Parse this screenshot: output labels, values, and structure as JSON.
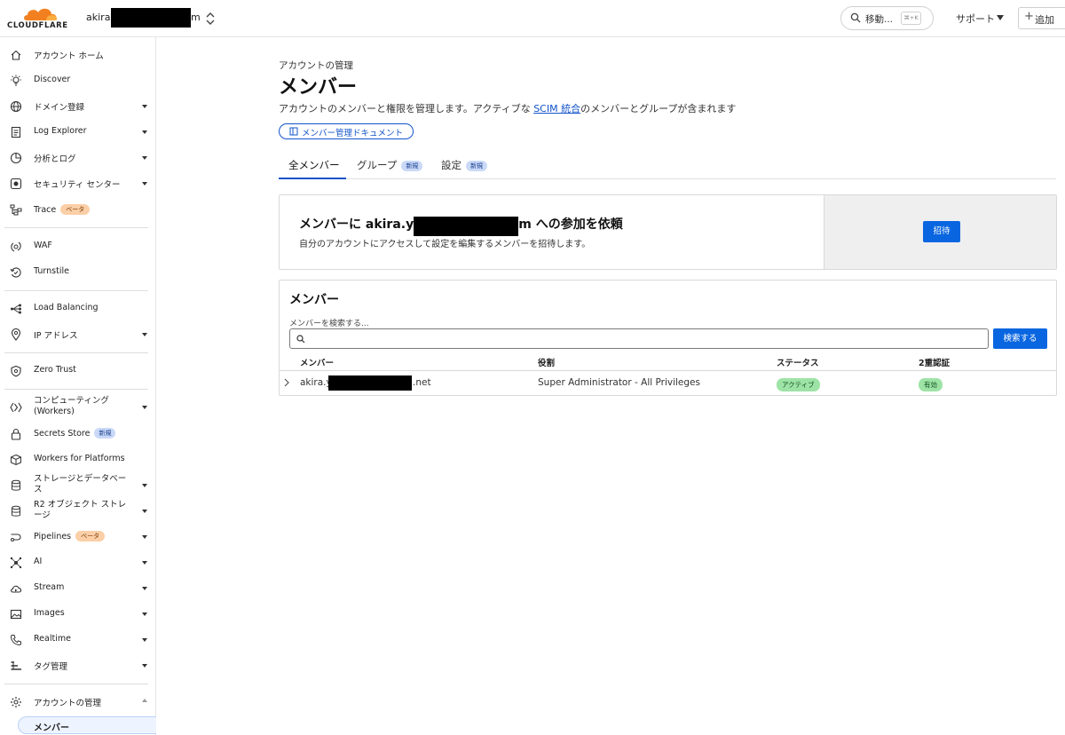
{
  "header": {
    "logo_text": "CLOUDFLARE",
    "account_name_prefix": "akira.y",
    "account_name_suffix": "m",
    "goto_label": "移動...",
    "goto_shortcut": "⌘+K",
    "support_label": "サポート",
    "add_label": "追加"
  },
  "sidebar": {
    "items": [
      {
        "label": "アカウント ホーム",
        "icon": "home-icon"
      },
      {
        "label": "Discover",
        "icon": "lightbulb-icon"
      },
      {
        "label": "ドメイン登録",
        "icon": "globe-icon"
      },
      {
        "label": "Log Explorer",
        "icon": "document-icon"
      },
      {
        "label": "分析とログ",
        "icon": "chart-pie-icon"
      },
      {
        "label": "セキュリティ センター",
        "icon": "security-center-icon"
      },
      {
        "label": "Trace",
        "icon": "trace-icon",
        "badge": "ベータ"
      },
      {
        "label": "WAF",
        "icon": "waf-icon"
      },
      {
        "label": "Turnstile",
        "icon": "turnstile-icon"
      },
      {
        "label": "Load Balancing",
        "icon": "load-balancing-icon"
      },
      {
        "label": "IP アドレス",
        "icon": "location-pin-icon"
      },
      {
        "label": "Zero Trust",
        "icon": "zero-trust-icon"
      },
      {
        "label": "コンピューティング (Workers)",
        "icon": "workers-icon"
      },
      {
        "label": "Secrets Store",
        "icon": "lock-icon",
        "badge": "新規"
      },
      {
        "label": "Workers for Platforms",
        "icon": "cube-icon"
      },
      {
        "label": "ストレージとデータベース",
        "icon": "database-icon"
      },
      {
        "label": "R2 オブジェクト ストレージ",
        "icon": "r2-storage-icon"
      },
      {
        "label": "Pipelines",
        "icon": "pipelines-icon",
        "badge": "ベータ"
      },
      {
        "label": "AI",
        "icon": "ai-icon"
      },
      {
        "label": "Stream",
        "icon": "stream-cloud-icon"
      },
      {
        "label": "Images",
        "icon": "image-icon"
      },
      {
        "label": "Realtime",
        "icon": "phone-icon"
      },
      {
        "label": "タグ管理",
        "icon": "tag-management-icon"
      },
      {
        "label": "アカウントの管理",
        "icon": "gear-icon"
      }
    ],
    "sub_item": "メンバー"
  },
  "main": {
    "breadcrumb": "アカウントの管理",
    "title": "メンバー",
    "desc_before": "アカウントのメンバーと権限を管理します。アクティブな ",
    "desc_link": "SCIM 統合",
    "desc_after": "のメンバーとグループが含まれます",
    "doc_button": "メンバー管理ドキュメント",
    "tabs": [
      {
        "label": "全メンバー"
      },
      {
        "label": "グループ",
        "badge": "新規"
      },
      {
        "label": "設定",
        "badge": "新規"
      }
    ],
    "invite": {
      "title_before": "メンバーに akira.y",
      "title_after": "m への参加を依頼",
      "subtitle": "自分のアカウントにアクセスして設定を編集するメンバーを招待します。",
      "button": "招待"
    },
    "members": {
      "title": "メンバー",
      "search_label": "メンバーを検索する...",
      "search_value": "",
      "search_button": "検索する",
      "columns": [
        "メンバー",
        "役割",
        "ステータス",
        "2重認証"
      ],
      "rows": [
        {
          "member_prefix": "akira.y",
          "member_suffix": ".net",
          "role": "Super Administrator - All Privileges",
          "status": "アクティブ",
          "two_factor": "有効"
        }
      ]
    }
  },
  "colors": {
    "accent": "#0a66e0",
    "link": "#1354c9",
    "logo_orange": "#f38020",
    "status_green": "#9ee3a6"
  }
}
